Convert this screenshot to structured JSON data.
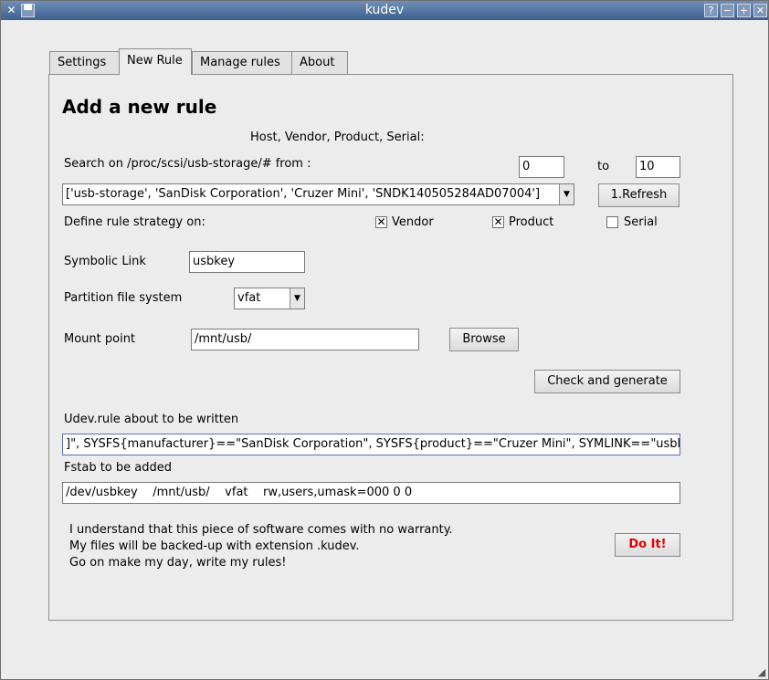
{
  "window": {
    "title": "kudev"
  },
  "tabs": [
    "Settings",
    "New Rule",
    "Manage rules",
    "About"
  ],
  "heading": "Add a new rule",
  "columns_hint": "Host, Vendor, Product, Serial:",
  "search": {
    "label": "Search on /proc/scsi/usb-storage/# from :",
    "from": "0",
    "to_label": "to",
    "to": "10"
  },
  "device_combo": {
    "value": "['usb-storage', 'SanDisk Corporation', 'Cruzer Mini', 'SNDK140505284AD07004']"
  },
  "refresh_button": "1.Refresh",
  "strategy": {
    "label": "Define rule strategy on:",
    "options": [
      {
        "label": "Vendor",
        "checked": true
      },
      {
        "label": "Product",
        "checked": true
      },
      {
        "label": "Serial",
        "checked": false
      }
    ]
  },
  "symlink": {
    "label": "Symbolic Link",
    "value": "usbkey"
  },
  "partition": {
    "label": "Partition file system",
    "value": "vfat"
  },
  "mount": {
    "label": "Mount point",
    "value": "/mnt/usb/",
    "browse_label": "Browse"
  },
  "check_button": "Check and generate",
  "udev": {
    "label": "Udev.rule about to be written",
    "value": "]\", SYSFS{manufacturer}==\"SanDisk Corporation\", SYSFS{product}==\"Cruzer Mini\", SYMLINK==\"usbke"
  },
  "fstab": {
    "label": "Fstab to be added",
    "value": "/dev/usbkey    /mnt/usb/    vfat    rw,users,umask=000 0 0"
  },
  "warranty_lines": [
    "I understand that this piece of software comes with no warranty.",
    "My files will be backed-up with extension .kudev.",
    "Go on make my day, write my rules!"
  ],
  "doit_button": "Do It!",
  "colors": {
    "titlebar": "#4d6d99",
    "doit_text": "#e00000"
  }
}
